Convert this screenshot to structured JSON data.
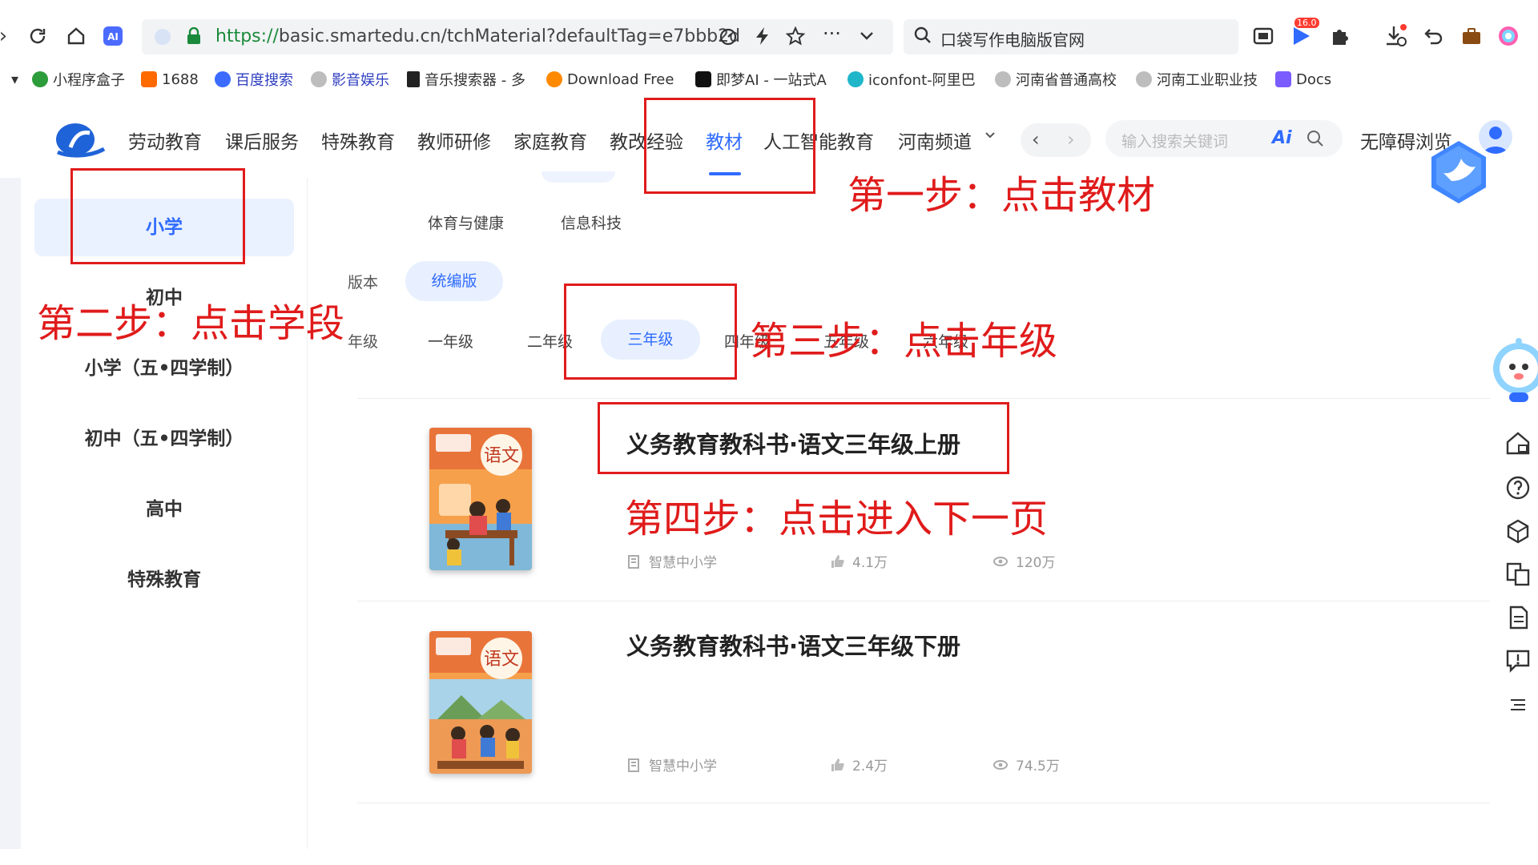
{
  "browser": {
    "url_scheme": "https://",
    "url_rest": "basic.smartedu.cn/tchMaterial?defaultTag=e7bbb2d",
    "search_placeholder": "口袋写作电脑版官网",
    "badge": "16.0"
  },
  "bookmarks": [
    {
      "label": "小程序盒子",
      "color": "#2d9c3a"
    },
    {
      "label": "1688",
      "color": "#ff6a00"
    },
    {
      "label": "百度搜索",
      "color": "#3b6cff"
    },
    {
      "label": "影音娱乐",
      "color": "#8a8a8a"
    },
    {
      "label": "音乐搜索器 - 多",
      "color": "#222222"
    },
    {
      "label": "Download Free",
      "color": "#ff8a00"
    },
    {
      "label": "即梦AI - 一站式A",
      "color": "#111111"
    },
    {
      "label": "iconfont-阿里巴",
      "color": "#1fb6c9"
    },
    {
      "label": "河南省普通高校",
      "color": "#8a8a8a"
    },
    {
      "label": "河南工业职业技",
      "color": "#8a8a8a"
    },
    {
      "label": "Docs",
      "color": "#7b5cff"
    }
  ],
  "nav": {
    "items": [
      "劳动教育",
      "课后服务",
      "特殊教育",
      "教师研修",
      "家庭教育",
      "教改经验",
      "教材",
      "人工智能教育",
      "河南频道"
    ],
    "active": "教材",
    "search_placeholder": "输入搜索关键词",
    "ai_label": "Ai",
    "accessibility": "无障碍浏览"
  },
  "sidebar": {
    "items": [
      "小学",
      "初中",
      "小学（五•四学制）",
      "初中（五•四学制）",
      "高中",
      "特殊教育"
    ],
    "active": "小学"
  },
  "filters": {
    "subject_row": [
      "体育与健康",
      "信息科技"
    ],
    "version_label": "版本",
    "version_selected": "统编版",
    "grade_label": "年级",
    "grades": [
      "一年级",
      "二年级",
      "三年级",
      "四年级",
      "五年级",
      "六年级"
    ],
    "grade_selected": "三年级"
  },
  "books": [
    {
      "title": "义务教育教科书·语文三年级上册",
      "publisher": "智慧中小学",
      "likes": "4.1万",
      "views": "120万",
      "cover_text": "语文"
    },
    {
      "title": "义务教育教科书·语文三年级下册",
      "publisher": "智慧中小学",
      "likes": "2.4万",
      "views": "74.5万",
      "cover_text": "语文"
    }
  ],
  "annotations": {
    "step1": "第一步：点击教材",
    "step2": "第二步：点击学段",
    "step3": "第三步：点击年级",
    "step4": "第四步：点击进入下一页"
  },
  "colors": {
    "accent": "#2f6bff",
    "annotation": "#e01b1b"
  }
}
